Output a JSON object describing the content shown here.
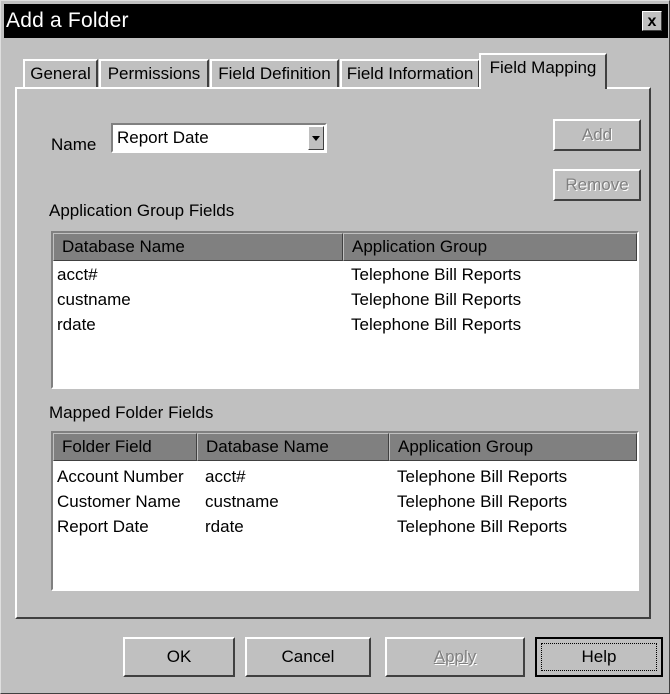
{
  "window": {
    "title": "Add a Folder",
    "close_label": "x"
  },
  "tabs": [
    {
      "label": "General"
    },
    {
      "label": "Permissions"
    },
    {
      "label": "Field Definition"
    },
    {
      "label": "Field Information"
    },
    {
      "label": "Field Mapping",
      "active": true
    }
  ],
  "name_field": {
    "label": "Name",
    "value": "Report Date"
  },
  "buttons": {
    "add": "Add",
    "remove": "Remove"
  },
  "app_group_fields": {
    "section_label": "Application Group Fields",
    "columns": [
      "Database Name",
      "Application Group"
    ],
    "rows": [
      [
        "acct#",
        "Telephone Bill Reports"
      ],
      [
        "custname",
        "Telephone Bill Reports"
      ],
      [
        "rdate",
        "Telephone Bill Reports"
      ]
    ]
  },
  "mapped_folder_fields": {
    "section_label": "Mapped Folder Fields",
    "columns": [
      "Folder Field",
      "Database Name",
      "Application Group"
    ],
    "rows": [
      [
        "Account Number",
        "acct#",
        "Telephone Bill Reports"
      ],
      [
        "Customer Name",
        "custname",
        "Telephone Bill Reports"
      ],
      [
        "Report Date",
        "rdate",
        "Telephone Bill Reports"
      ]
    ]
  },
  "dialog_buttons": {
    "ok": "OK",
    "cancel": "Cancel",
    "apply": "Apply",
    "help": "Help"
  }
}
